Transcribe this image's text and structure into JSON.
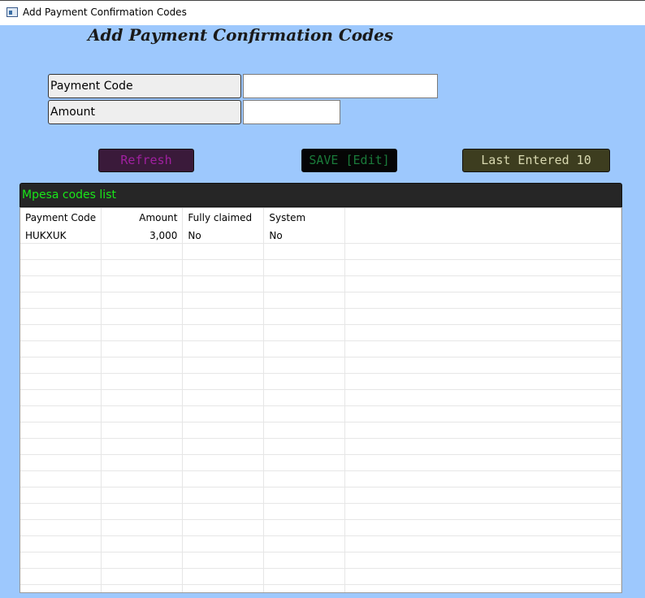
{
  "window": {
    "title": "Add Payment Confirmation Codes"
  },
  "page": {
    "heading": "Add Payment Confirmation Codes"
  },
  "form": {
    "payment_code_label": "Payment Code",
    "payment_code_value": "",
    "amount_label": "Amount",
    "amount_value": ""
  },
  "buttons": {
    "refresh": "Refresh",
    "save": "SAVE [Edit]",
    "last_entered": "Last Entered 10"
  },
  "list": {
    "title": "Mpesa codes list",
    "columns": [
      "Payment Code",
      "Amount",
      "Fully claimed",
      "System"
    ],
    "rows": [
      [
        "HUKXUK",
        "3,000",
        "No",
        "No"
      ]
    ]
  },
  "colors": {
    "background": "#9dc8fd",
    "refresh_bg": "#3a1a3a",
    "refresh_fg": "#a020a0",
    "save_bg": "#050505",
    "save_fg": "#1a7a3a",
    "last_bg": "#3d3d1f",
    "last_fg": "#d8d8b0",
    "list_header_bg": "#262626",
    "list_header_fg": "#19e619"
  }
}
